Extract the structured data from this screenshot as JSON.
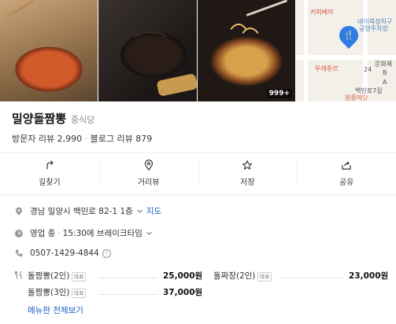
{
  "place": {
    "name": "밀양돌짬뽕",
    "category": "중식당",
    "visitor_review_label": "방문자 리뷰",
    "visitor_review_count": "2,990",
    "blog_review_label": "블로그 리뷰",
    "blog_review_count": "879"
  },
  "photos": {
    "count_badge": "999+"
  },
  "map": {
    "labels": [
      "커피베이",
      "네이북성지구",
      "공영주차장",
      "문화체",
      "뚜레쥬르",
      "24",
      "백민로7길",
      "A",
      "B",
      "원풍어당"
    ]
  },
  "actions": [
    {
      "label": "길찾기",
      "icon": "directions-icon"
    },
    {
      "label": "거리뷰",
      "icon": "location-pin-icon"
    },
    {
      "label": "저장",
      "icon": "star-icon"
    },
    {
      "label": "공유",
      "icon": "share-icon"
    }
  ],
  "info": {
    "address": "경남 밀양시 백민로 82-1 1층",
    "directions_link": "지도",
    "hours_status": "영업 중",
    "hours_detail": "15:30에 브레이크타임",
    "phone": "0507-1429-4844",
    "phone_info": "i"
  },
  "menu": {
    "rep_tag": "대표",
    "items": [
      {
        "name": "돌짬뽕(2인)",
        "price": "25,000원"
      },
      {
        "name": "돌짜장(2인)",
        "price": "23,000원"
      },
      {
        "name": "돌짬뽕(3인)",
        "price": "37,000원"
      }
    ],
    "more_link": "메뉴판 전체보기"
  },
  "colors": {
    "link_blue": "#1a5dc9",
    "pin_blue": "#2d7de2"
  }
}
